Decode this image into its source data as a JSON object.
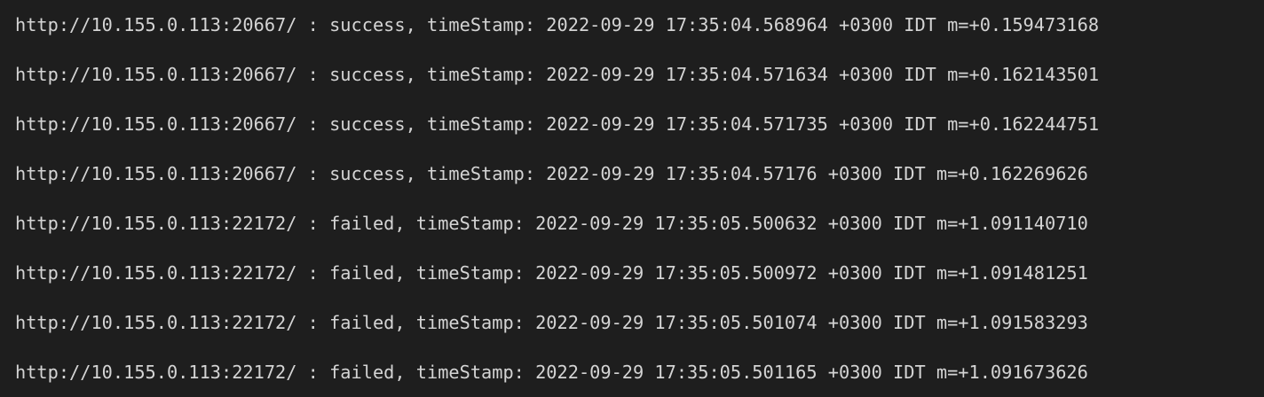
{
  "terminal": {
    "lines": [
      "http://10.155.0.113:20667/ : success, timeStamp: 2022-09-29 17:35:04.568964 +0300 IDT m=+0.159473168",
      "http://10.155.0.113:20667/ : success, timeStamp: 2022-09-29 17:35:04.571634 +0300 IDT m=+0.162143501",
      "http://10.155.0.113:20667/ : success, timeStamp: 2022-09-29 17:35:04.571735 +0300 IDT m=+0.162244751",
      "http://10.155.0.113:20667/ : success, timeStamp: 2022-09-29 17:35:04.57176 +0300 IDT m=+0.162269626",
      "http://10.155.0.113:22172/ : failed, timeStamp: 2022-09-29 17:35:05.500632 +0300 IDT m=+1.091140710",
      "http://10.155.0.113:22172/ : failed, timeStamp: 2022-09-29 17:35:05.500972 +0300 IDT m=+1.091481251",
      "http://10.155.0.113:22172/ : failed, timeStamp: 2022-09-29 17:35:05.501074 +0300 IDT m=+1.091583293",
      "http://10.155.0.113:22172/ : failed, timeStamp: 2022-09-29 17:35:05.501165 +0300 IDT m=+1.091673626"
    ]
  },
  "colors": {
    "background": "#1e1e1e",
    "text": "#d4d4d4"
  }
}
